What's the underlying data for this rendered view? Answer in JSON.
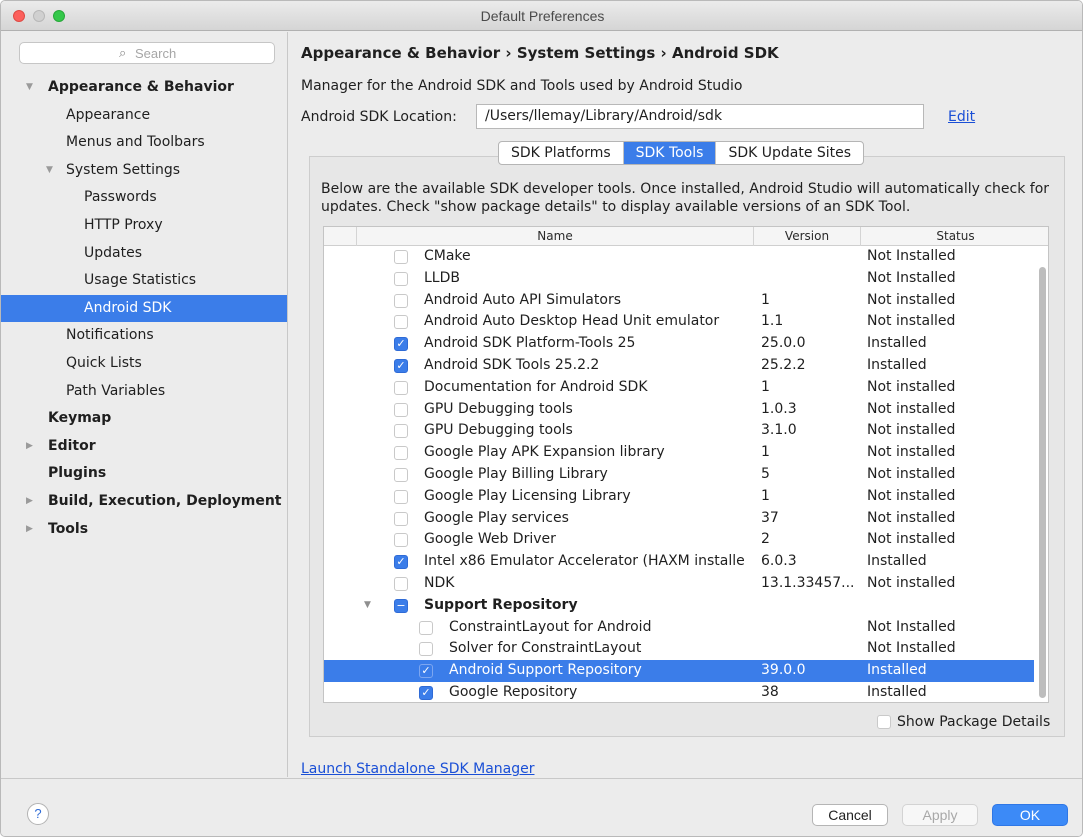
{
  "window": {
    "title": "Default Preferences"
  },
  "sidebar": {
    "search_placeholder": "Search",
    "items": [
      {
        "label": "Appearance & Behavior",
        "bold": true,
        "arrow": "expanded",
        "indent": 0
      },
      {
        "label": "Appearance",
        "bold": false,
        "indent": 1
      },
      {
        "label": "Menus and Toolbars",
        "bold": false,
        "indent": 1
      },
      {
        "label": "System Settings",
        "bold": false,
        "arrow": "expanded",
        "indent": 1
      },
      {
        "label": "Passwords",
        "bold": false,
        "indent": 2
      },
      {
        "label": "HTTP Proxy",
        "bold": false,
        "indent": 2
      },
      {
        "label": "Updates",
        "bold": false,
        "indent": 2
      },
      {
        "label": "Usage Statistics",
        "bold": false,
        "indent": 2
      },
      {
        "label": "Android SDK",
        "bold": false,
        "indent": 2,
        "selected": true
      },
      {
        "label": "Notifications",
        "bold": false,
        "indent": 1
      },
      {
        "label": "Quick Lists",
        "bold": false,
        "indent": 1
      },
      {
        "label": "Path Variables",
        "bold": false,
        "indent": 1
      },
      {
        "label": "Keymap",
        "bold": true,
        "indent": 0
      },
      {
        "label": "Editor",
        "bold": true,
        "arrow": "collapsed",
        "indent": 0
      },
      {
        "label": "Plugins",
        "bold": true,
        "indent": 0
      },
      {
        "label": "Build, Execution, Deployment",
        "bold": true,
        "arrow": "collapsed",
        "indent": 0
      },
      {
        "label": "Tools",
        "bold": true,
        "arrow": "collapsed",
        "indent": 0
      }
    ]
  },
  "main": {
    "breadcrumb": "Appearance & Behavior › System Settings › Android SDK",
    "description": "Manager for the Android SDK and Tools used by Android Studio",
    "sdk_location_label": "Android SDK Location:",
    "sdk_location_value": "/Users/llemay/Library/Android/sdk",
    "edit_label": "Edit",
    "tabs": [
      {
        "label": "SDK Platforms",
        "active": false
      },
      {
        "label": "SDK Tools",
        "active": true
      },
      {
        "label": "SDK Update Sites",
        "active": false
      }
    ],
    "panel_description": "Below are the available SDK developer tools. Once installed, Android Studio will automatically check for updates. Check \"show package details\" to display available versions of an SDK Tool.",
    "table": {
      "columns": [
        "Name",
        "Version",
        "Status"
      ],
      "rows": [
        {
          "name": "CMake",
          "version": "",
          "status": "Not Installed",
          "checked": false,
          "level": 0
        },
        {
          "name": "LLDB",
          "version": "",
          "status": "Not Installed",
          "checked": false,
          "level": 0
        },
        {
          "name": "Android Auto API Simulators",
          "version": "1",
          "status": "Not installed",
          "checked": false,
          "level": 0
        },
        {
          "name": "Android Auto Desktop Head Unit emulator",
          "version": "1.1",
          "status": "Not installed",
          "checked": false,
          "level": 0
        },
        {
          "name": "Android SDK Platform-Tools 25",
          "version": "25.0.0",
          "status": "Installed",
          "checked": true,
          "level": 0
        },
        {
          "name": "Android SDK Tools 25.2.2",
          "version": "25.2.2",
          "status": "Installed",
          "checked": true,
          "level": 0
        },
        {
          "name": "Documentation for Android SDK",
          "version": "1",
          "status": "Not installed",
          "checked": false,
          "level": 0
        },
        {
          "name": "GPU Debugging tools",
          "version": "1.0.3",
          "status": "Not installed",
          "checked": false,
          "level": 0
        },
        {
          "name": "GPU Debugging tools",
          "version": "3.1.0",
          "status": "Not installed",
          "checked": false,
          "level": 0
        },
        {
          "name": "Google Play APK Expansion library",
          "version": "1",
          "status": "Not installed",
          "checked": false,
          "level": 0
        },
        {
          "name": "Google Play Billing Library",
          "version": "5",
          "status": "Not installed",
          "checked": false,
          "level": 0
        },
        {
          "name": "Google Play Licensing Library",
          "version": "1",
          "status": "Not installed",
          "checked": false,
          "level": 0
        },
        {
          "name": "Google Play services",
          "version": "37",
          "status": "Not installed",
          "checked": false,
          "level": 0
        },
        {
          "name": "Google Web Driver",
          "version": "2",
          "status": "Not installed",
          "checked": false,
          "level": 0
        },
        {
          "name": "Intel x86 Emulator Accelerator (HAXM installe",
          "version": "6.0.3",
          "status": "Installed",
          "checked": true,
          "level": 0
        },
        {
          "name": "NDK",
          "version": "13.1.33457...",
          "status": "Not installed",
          "checked": false,
          "level": 0
        },
        {
          "name": "Support Repository",
          "version": "",
          "status": "",
          "checked": "partial",
          "level": 0,
          "group": true
        },
        {
          "name": "ConstraintLayout for Android",
          "version": "",
          "status": "Not Installed",
          "checked": false,
          "level": 1
        },
        {
          "name": "Solver for ConstraintLayout",
          "version": "",
          "status": "Not Installed",
          "checked": false,
          "level": 1
        },
        {
          "name": "Android Support Repository",
          "version": "39.0.0",
          "status": "Installed",
          "checked": true,
          "level": 1,
          "selected": true
        },
        {
          "name": "Google Repository",
          "version": "38",
          "status": "Installed",
          "checked": true,
          "level": 1
        }
      ]
    },
    "show_package_details_label": "Show Package Details",
    "launch_link": "Launch Standalone SDK Manager"
  },
  "footer": {
    "help_label": "?",
    "cancel_label": "Cancel",
    "apply_label": "Apply",
    "ok_label": "OK"
  },
  "colors": {
    "accent": "#3b7de9",
    "ok_button": "#3c8af7",
    "link": "#1a4fd6",
    "close_light": "#fc605c",
    "zoom_light": "#34c84a"
  },
  "icons": {
    "search": "search-icon",
    "check": "checkmark-icon",
    "partial": "minus-icon",
    "expanded": "triangle-down-icon",
    "collapsed": "triangle-right-icon",
    "help": "help-icon"
  }
}
